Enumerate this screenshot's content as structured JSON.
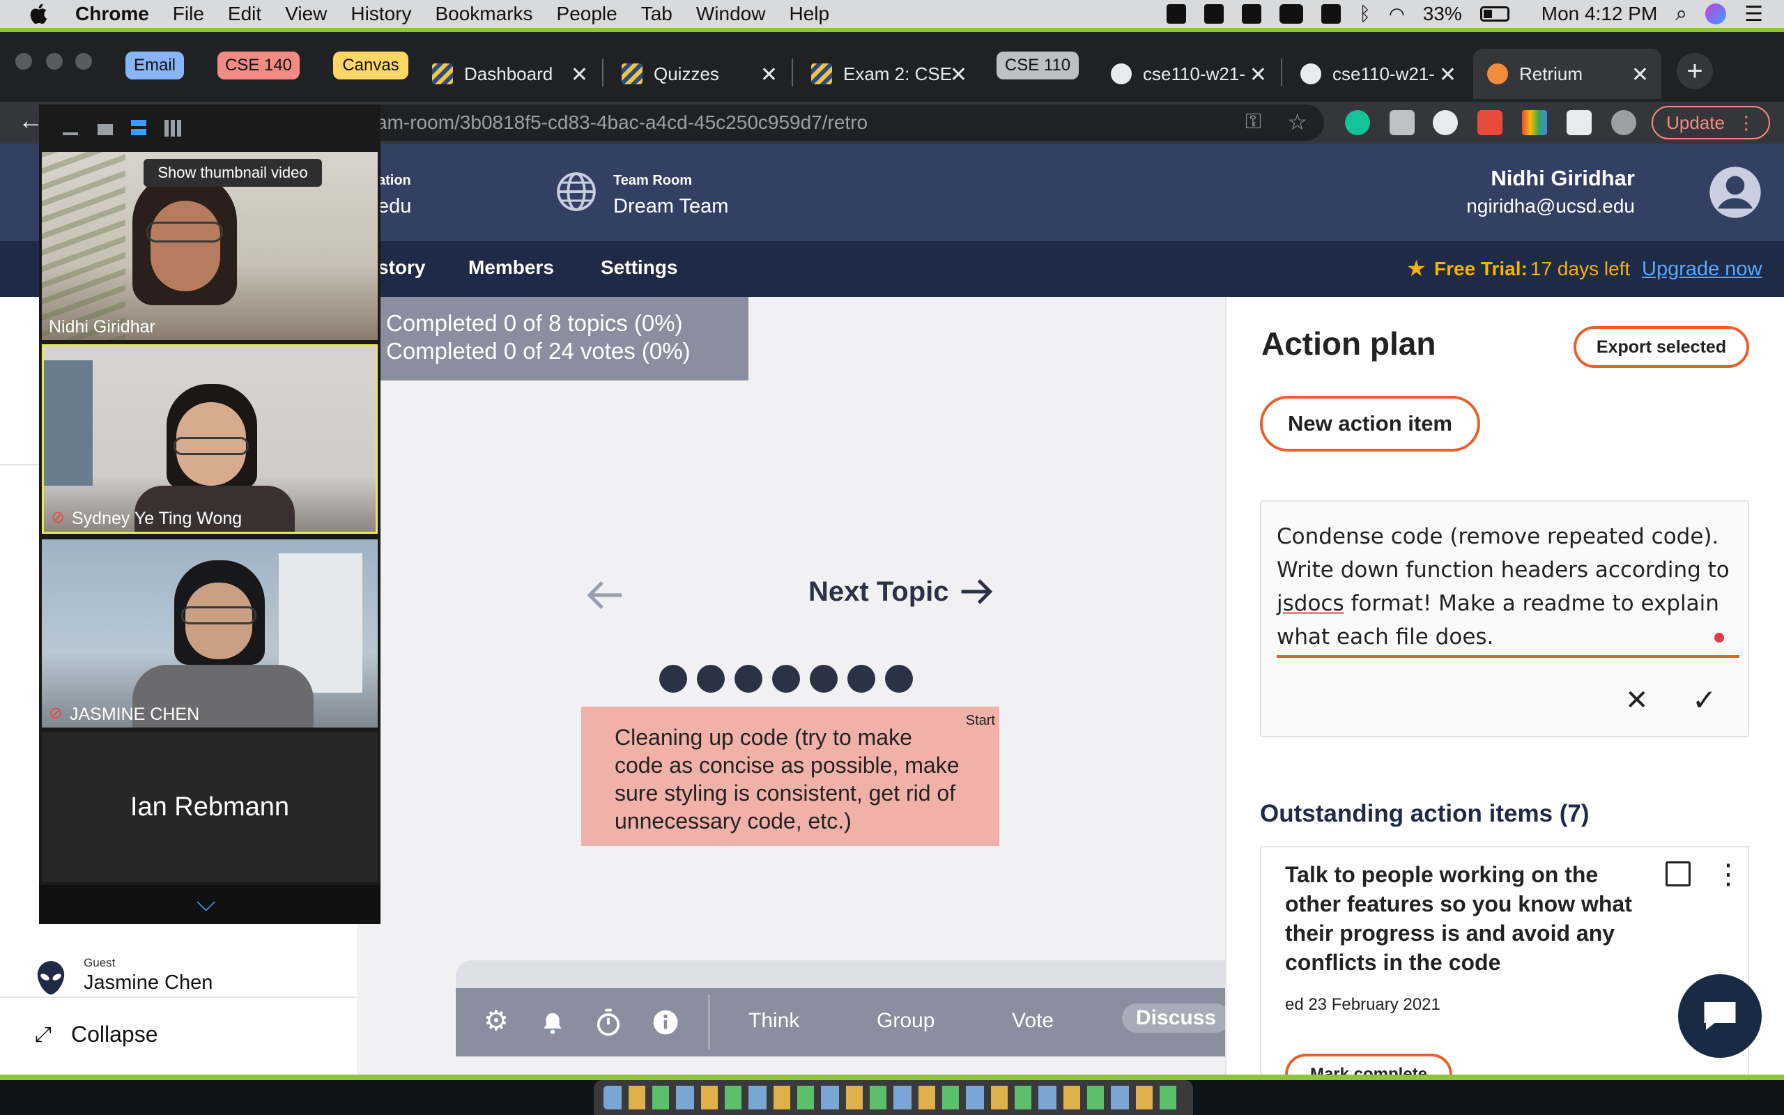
{
  "menubar": {
    "app": "Chrome",
    "items": [
      "File",
      "Edit",
      "View",
      "History",
      "Bookmarks",
      "People",
      "Tab",
      "Window",
      "Help"
    ],
    "battery": "33%",
    "clock": "Mon 4:12 PM"
  },
  "tabs": {
    "groups": [
      {
        "label": "Email",
        "color": "#8ab4f8"
      },
      {
        "label": "CSE 140",
        "color": "#f28b82"
      },
      {
        "label": "Canvas",
        "color": "#fdd663"
      },
      {
        "label": "CSE 110",
        "color": "#bdc1c6"
      }
    ],
    "items": [
      {
        "label": "Dashboard"
      },
      {
        "label": "Quizzes"
      },
      {
        "label": "Exam 2: CSE"
      },
      {
        "label": "cse110-w21-"
      },
      {
        "label": "cse110-w21-"
      },
      {
        "label": "Retrium"
      }
    ]
  },
  "omnibox": {
    "url": "am-room/3b0818f5-cd83-4bac-a4cd-45c250c959d7/retro",
    "update_label": "Update"
  },
  "header": {
    "org_label": "ation",
    "org_value": "edu",
    "team_room_label": "Team Room",
    "team_room_value": "Dream Team",
    "user_name": "Nidhi Giridhar",
    "user_email": "ngiridha@ucsd.edu"
  },
  "nav": {
    "history": "story",
    "members": "Members",
    "settings": "Settings",
    "trial_label": "Free Trial:",
    "trial_value": "17 days left",
    "upgrade": "Upgrade now"
  },
  "progress": {
    "topics": "Completed 0 of 8 topics (0%)",
    "votes": "Completed 0 of 24 votes (0%)"
  },
  "topic": {
    "next_label": "Next Topic",
    "dots_count": 7,
    "start_label": "Start",
    "card_text": "Cleaning up code (try to make code as concise as possible, make sure styling is consistent, get rid of unnecessary code, etc.)"
  },
  "phases": {
    "items": [
      "Think",
      "Group",
      "Vote",
      "Discuss"
    ],
    "active": "Discuss"
  },
  "action_plan": {
    "title": "Action plan",
    "export_label": "Export selected",
    "new_item_label": "New action item",
    "draft_text_before": "Condense code (remove repeated code). Write down function headers according to ",
    "draft_text_misspelled": "jsdocs",
    "draft_text_after": " format! Make a readme to explain what each file does.",
    "outstanding_title": "Outstanding action items (7)",
    "outstanding_item_text": "Talk to people working on the other features so you know what their progress is and avoid any conflicts in the code",
    "outstanding_item_date": "ed 23 February 2021",
    "mark_complete": "Mark complete"
  },
  "sidebar": {
    "guest_label": "Guest",
    "guest_name": "Jasmine Chen",
    "collapse_label": "Collapse"
  },
  "zoom": {
    "tooltip": "Show thumbnail video",
    "participants": [
      {
        "name": "Nidhi Giridhar"
      },
      {
        "name": "Sydney Ye Ting Wong"
      },
      {
        "name": "JASMINE CHEN"
      },
      {
        "name": "Ian Rebmann"
      }
    ]
  },
  "colors": {
    "accent": "#e8612c",
    "header": "#334063",
    "nav": "#1f2a46",
    "card": "#f0b1a8"
  }
}
